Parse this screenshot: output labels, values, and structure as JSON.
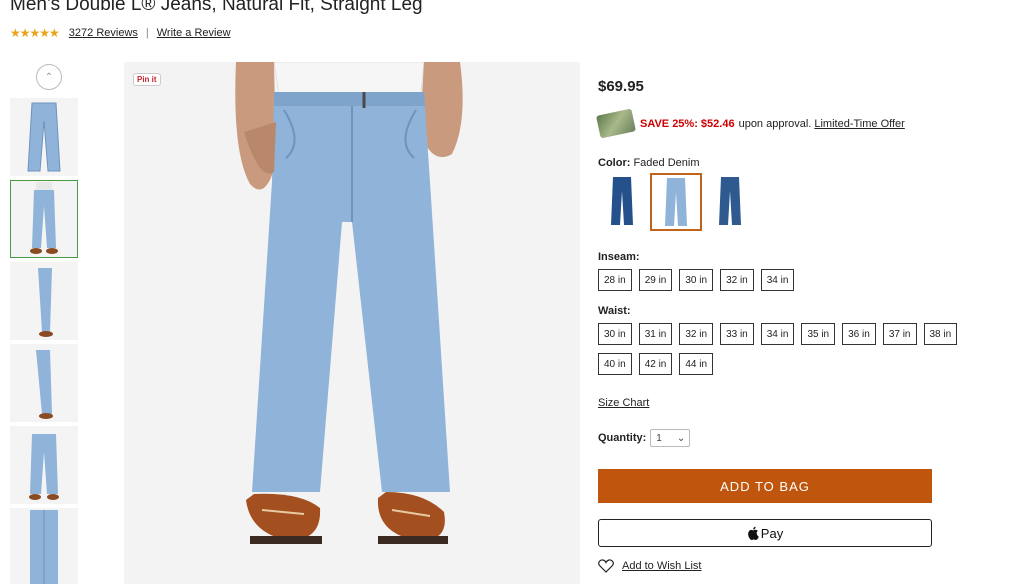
{
  "product": {
    "title": "Men's Double L® Jeans, Natural Fit, Straight Leg",
    "rating": 4.6,
    "stars_text": "★★★★★",
    "reviews_link": "3272 Reviews",
    "write_review": "Write a Review",
    "separator": "|"
  },
  "gallery": {
    "pin_label": "Pin it",
    "thumbnail_count": 6,
    "active_thumbnail": 1
  },
  "purchase": {
    "price": "$69.95",
    "promo_save": "SAVE 25%: $52.46",
    "promo_text": "upon approval.",
    "promo_link": "Limited-Time Offer",
    "color_label": "Color:",
    "color_value": "Faded Denim",
    "swatch_colors": [
      "#24508c",
      "#8fb3d9",
      "#2f5a8f"
    ],
    "inseam_label": "Inseam:",
    "inseam_sizes": [
      "28 in",
      "29 in",
      "30 in",
      "32 in",
      "34 in"
    ],
    "waist_label": "Waist:",
    "waist_sizes": [
      "30 in",
      "31 in",
      "32 in",
      "33 in",
      "34 in",
      "35 in",
      "36 in",
      "37 in",
      "38 in",
      "40 in",
      "42 in",
      "44 in"
    ],
    "size_chart": "Size Chart",
    "quantity_label": "Quantity:",
    "quantity_value": "1",
    "add_to_bag": "ADD TO BAG",
    "apple_pay": "Pay",
    "wish_list": "Add to Wish List",
    "accent_color": "#c0560d"
  }
}
